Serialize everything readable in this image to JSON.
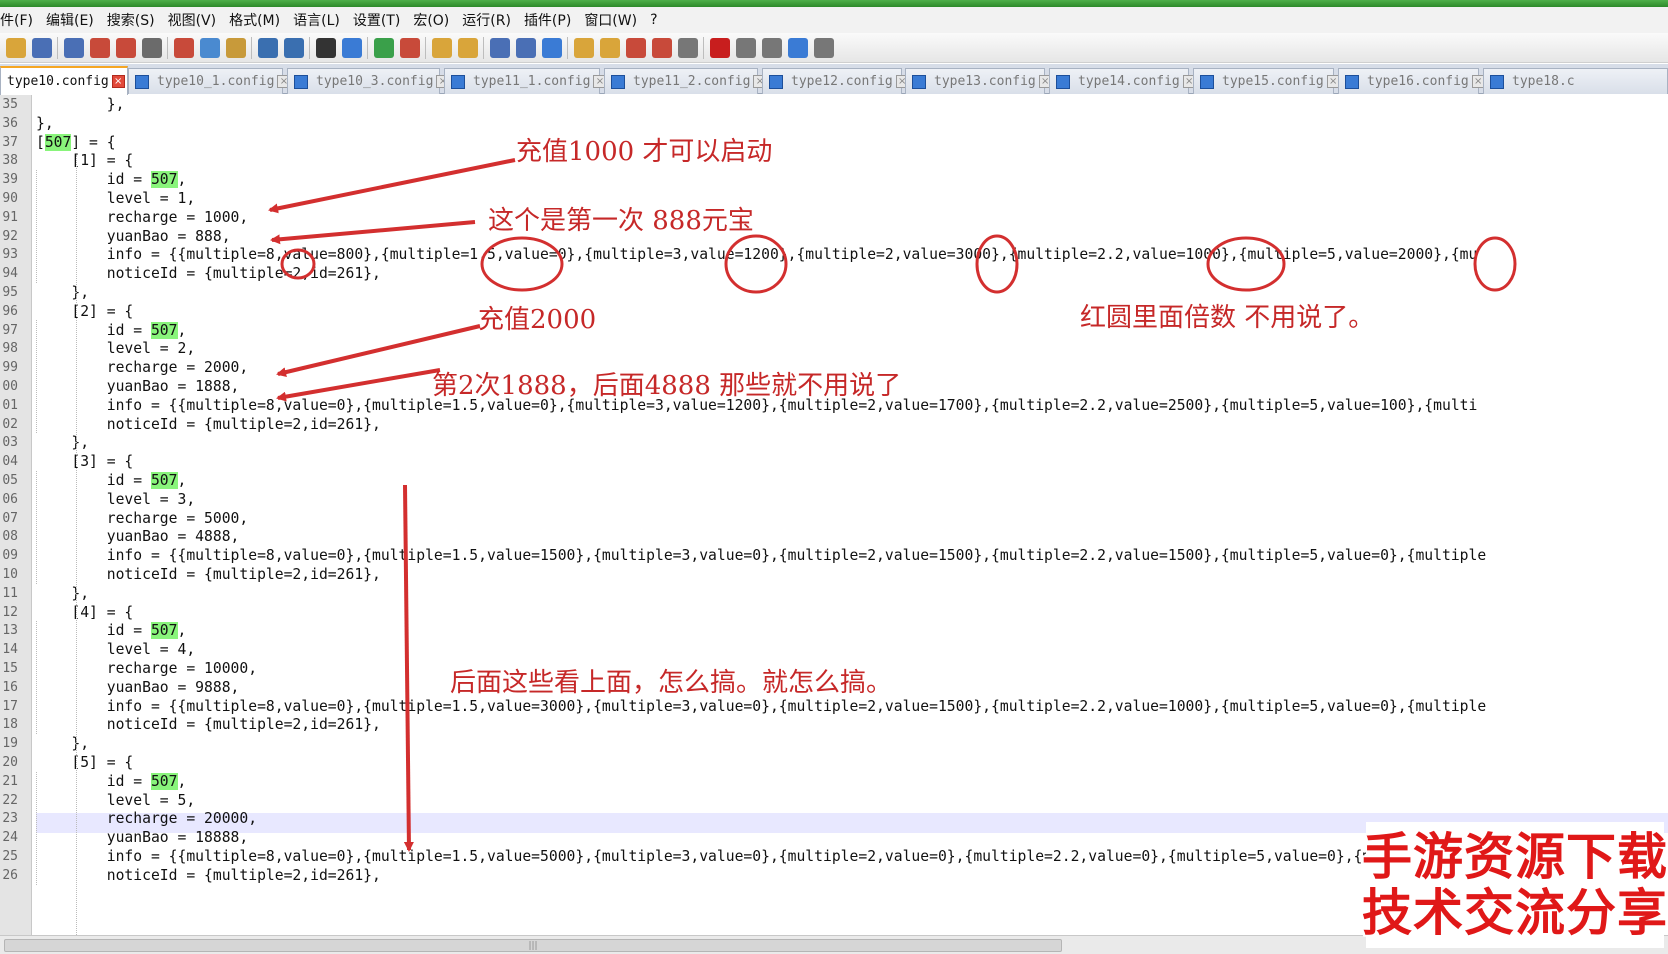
{
  "menu": [
    "件(F)",
    "编辑(E)",
    "搜索(S)",
    "视图(V)",
    "格式(M)",
    "语言(L)",
    "设置(T)",
    "宏(O)",
    "运行(R)",
    "插件(P)",
    "窗口(W)",
    "?"
  ],
  "toolbar_icons": [
    "open-file-icon",
    "save-icon",
    "save-all-icon",
    "close-icon",
    "close-all-icon",
    "print-icon",
    "cut-icon",
    "copy-icon",
    "paste-icon",
    "undo-icon",
    "redo-icon",
    "find-icon",
    "replace-icon",
    "zoom-in-icon",
    "zoom-out-icon",
    "sync-v-icon",
    "sync-h-icon",
    "word-wrap-icon",
    "show-all-chars-icon",
    "indent-guide-icon",
    "udl-icon",
    "doc-map-icon",
    "function-list-icon",
    "folder-workspace-icon",
    "monitoring-icon",
    "record-macro-icon",
    "stop-macro-icon",
    "play-macro-icon",
    "run-macro-multiple-icon",
    "save-macro-icon"
  ],
  "tabs": [
    {
      "label": "type10.config",
      "active": true
    },
    {
      "label": "type10_1.config",
      "active": false
    },
    {
      "label": "type10_3.config",
      "active": false
    },
    {
      "label": "type11_1.config",
      "active": false
    },
    {
      "label": "type11_2.config",
      "active": false
    },
    {
      "label": "type12.config",
      "active": false
    },
    {
      "label": "type13.config",
      "active": false
    },
    {
      "label": "type14.config",
      "active": false
    },
    {
      "label": "type15.config",
      "active": false
    },
    {
      "label": "type16.config",
      "active": false
    },
    {
      "label": "type18.c",
      "active": false
    }
  ],
  "line_numbers": [
    "35",
    "36",
    "37",
    "38",
    "39",
    "90",
    "91",
    "92",
    "93",
    "94",
    "95",
    "96",
    "97",
    "98",
    "99",
    "00",
    "01",
    "02",
    "03",
    "04",
    "05",
    "06",
    "07",
    "08",
    "09",
    "10",
    "11",
    "12",
    "13",
    "14",
    "15",
    "16",
    "17",
    "18",
    "19",
    "20",
    "21",
    "22",
    "23",
    "24",
    "25",
    "26"
  ],
  "code": [
    [
      {
        "t": "        },"
      }
    ],
    [
      {
        "t": "},"
      }
    ],
    [
      {
        "t": "["
      },
      {
        "t": "507",
        "hl": true
      },
      {
        "t": "] = {"
      }
    ],
    [
      {
        "t": "    [1] = {"
      }
    ],
    [
      {
        "t": "        id = "
      },
      {
        "t": "507",
        "hl": true
      },
      {
        "t": ","
      }
    ],
    [
      {
        "t": "        level = 1,"
      }
    ],
    [
      {
        "t": "        recharge = 1000,"
      }
    ],
    [
      {
        "t": "        yuanBao = 888,"
      }
    ],
    [
      {
        "t": "        info = {{multiple=8,value=800},{multiple=1.5,value=0},{multiple=3,value=1200},{multiple=2,value=3000},{multiple=2.2,value=1000},{multiple=5,value=2000},{mu"
      }
    ],
    [
      {
        "t": "        noticeId = {multiple=2,id=261},"
      }
    ],
    [
      {
        "t": "    },"
      }
    ],
    [
      {
        "t": "    [2] = {"
      }
    ],
    [
      {
        "t": "        id = "
      },
      {
        "t": "507",
        "hl": true
      },
      {
        "t": ","
      }
    ],
    [
      {
        "t": "        level = 2,"
      }
    ],
    [
      {
        "t": "        recharge = 2000,"
      }
    ],
    [
      {
        "t": "        yuanBao = 1888,"
      }
    ],
    [
      {
        "t": "        info = {{multiple=8,value=0},{multiple=1.5,value=0},{multiple=3,value=1200},{multiple=2,value=1700},{multiple=2.2,value=2500},{multiple=5,value=100},{multi"
      }
    ],
    [
      {
        "t": "        noticeId = {multiple=2,id=261},"
      }
    ],
    [
      {
        "t": "    },"
      }
    ],
    [
      {
        "t": "    [3] = {"
      }
    ],
    [
      {
        "t": "        id = "
      },
      {
        "t": "507",
        "hl": true
      },
      {
        "t": ","
      }
    ],
    [
      {
        "t": "        level = 3,"
      }
    ],
    [
      {
        "t": "        recharge = 5000,"
      }
    ],
    [
      {
        "t": "        yuanBao = 4888,"
      }
    ],
    [
      {
        "t": "        info = {{multiple=8,value=0},{multiple=1.5,value=1500},{multiple=3,value=0},{multiple=2,value=1500},{multiple=2.2,value=1500},{multiple=5,value=0},{multiple"
      }
    ],
    [
      {
        "t": "        noticeId = {multiple=2,id=261},"
      }
    ],
    [
      {
        "t": "    },"
      }
    ],
    [
      {
        "t": "    [4] = {"
      }
    ],
    [
      {
        "t": "        id = "
      },
      {
        "t": "507",
        "hl": true
      },
      {
        "t": ","
      }
    ],
    [
      {
        "t": "        level = 4,"
      }
    ],
    [
      {
        "t": "        recharge = 10000,"
      }
    ],
    [
      {
        "t": "        yuanBao = 9888,"
      }
    ],
    [
      {
        "t": "        info = {{multiple=8,value=0},{multiple=1.5,value=3000},{multiple=3,value=0},{multiple=2,value=1500},{multiple=2.2,value=1000},{multiple=5,value=0},{multiple"
      }
    ],
    [
      {
        "t": "        noticeId = {multiple=2,id=261},"
      }
    ],
    [
      {
        "t": "    },"
      }
    ],
    [
      {
        "t": "    [5] = {"
      }
    ],
    [
      {
        "t": "        id = "
      },
      {
        "t": "507",
        "hl": true
      },
      {
        "t": ","
      }
    ],
    [
      {
        "t": "        level = 5,"
      }
    ],
    [
      {
        "t": "        recharge = 20000,"
      }
    ],
    [
      {
        "t": "        yuanBao = 18888,"
      }
    ],
    [
      {
        "t": "        info = {{multiple=8,value=0},{multiple=1.5,value=5000},{multiple=3,value=0},{multiple=2,value=0},{multiple=2.2,value=0},{multiple=5,value=0},{mul"
      }
    ],
    [
      {
        "t": "        noticeId = {multiple=2,id=261},"
      }
    ]
  ],
  "annotations": {
    "note1": "充值1000  才可以启动",
    "note2": "这个是第一次  888元宝",
    "note3": "充值2000",
    "note4": "红圆里面倍数  不用说了。",
    "note5": "第2次1888，后面4888  那些就不用说了",
    "note6": "后面这些看上面，怎么搞。就怎么搞。"
  },
  "watermark": {
    "line1": "手游资源下载",
    "line2": "技术交流分享"
  },
  "colors": {
    "annotation_red": "#d32f2f",
    "highlight_green": "#89f47b",
    "current_line": "#e8e8ff",
    "active_tab_accent": "#f5a623"
  }
}
